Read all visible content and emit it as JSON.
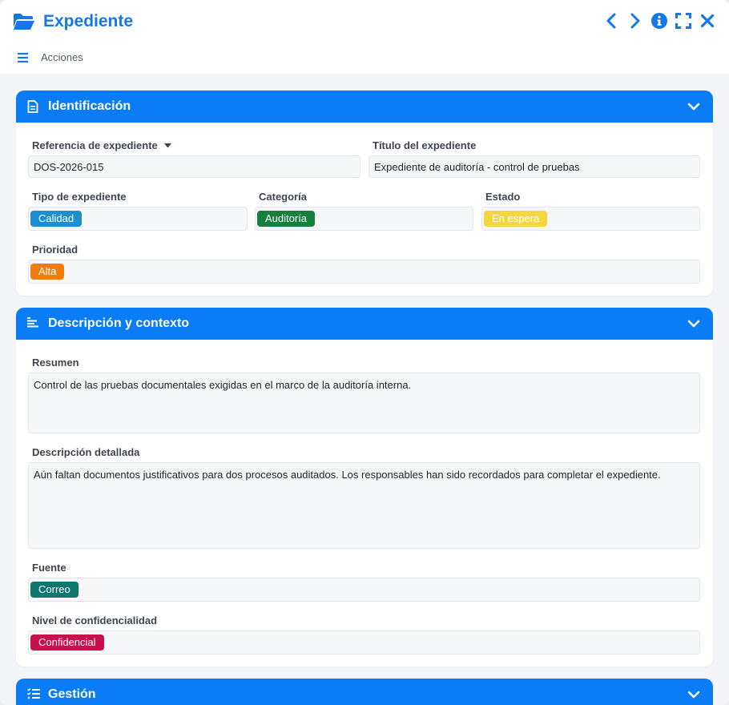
{
  "window": {
    "title": "Expediente",
    "actions_label": "Acciones",
    "controls": [
      "chevron-left-icon",
      "chevron-right-icon",
      "info-icon",
      "fullscreen-icon",
      "close-icon"
    ]
  },
  "colors": {
    "accent": "#0a7cf5",
    "tag_calidad": "#1b8fd1",
    "tag_auditoria": "#15803d",
    "tag_espera": "#f5d63d",
    "tag_alta": "#f07d0b",
    "tag_correo": "#0f766e",
    "tag_confidencial": "#c8104f"
  },
  "identificacion": {
    "title": "Identificación",
    "referencia_label": "Referencia de expediente",
    "referencia_value": "DOS-2026-015",
    "titulo_label": "Título del expediente",
    "titulo_value": "Expediente de auditoría - control de pruebas",
    "tipo_label": "Tipo de expediente",
    "tipo_value": "Calidad",
    "categoria_label": "Categoría",
    "categoria_value": "Auditoría",
    "estado_label": "Estado",
    "estado_value": "En espera",
    "prioridad_label": "Prioridad",
    "prioridad_value": "Alta"
  },
  "descripcion": {
    "title": "Descripción y contexto",
    "resumen_label": "Resumen",
    "resumen_value": "Control de las pruebas documentales exigidas en el marco de la auditoría interna.",
    "detallada_label": "Descripción detallada",
    "detallada_value": "Aún faltan documentos justificativos para dos procesos auditados. Los responsables han sido recordados para completar el expediente.",
    "fuente_label": "Fuente",
    "fuente_value": "Correo",
    "nivel_label": "Nivel de confidencialidad",
    "nivel_value": "Confidencial"
  },
  "gestion": {
    "title": "Gestión"
  }
}
